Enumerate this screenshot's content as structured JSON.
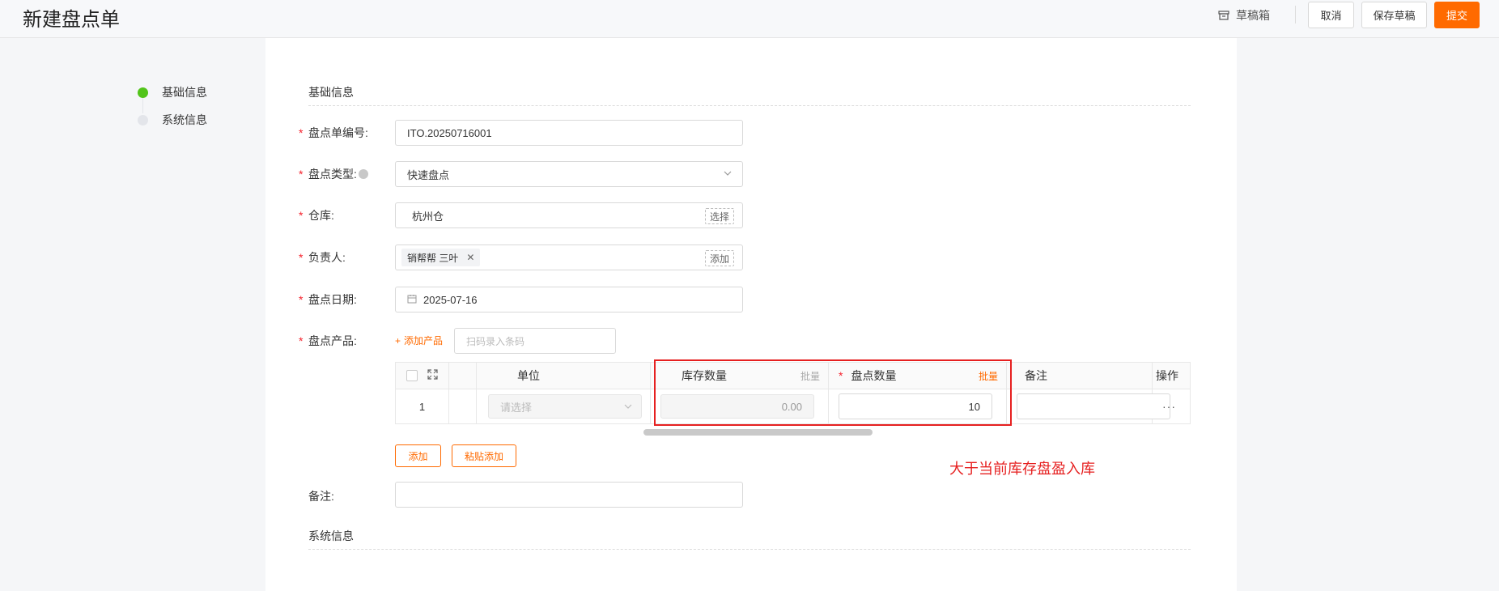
{
  "header": {
    "title": "新建盘点单",
    "draft_box_label": "草稿箱",
    "cancel_label": "取消",
    "save_draft_label": "保存草稿",
    "submit_label": "提交",
    "accent_color": "#ff6a00"
  },
  "steps": [
    {
      "label": "基础信息",
      "status": "active",
      "color": "#52c41a"
    },
    {
      "label": "系统信息",
      "status": "pending"
    }
  ],
  "sections": {
    "basic": "基础信息",
    "system": "系统信息"
  },
  "form": {
    "code": {
      "label": "盘点单编号:",
      "value": "ITO.20250716001"
    },
    "type": {
      "label": "盘点类型:",
      "value": "快速盘点"
    },
    "warehouse": {
      "label": "仓库:",
      "value": "杭州仓",
      "action": "选择"
    },
    "owner": {
      "label": "负责人:",
      "tag": "销帮帮 三叶",
      "action": "添加"
    },
    "date": {
      "label": "盘点日期:",
      "value": "2025-07-16"
    },
    "products": {
      "label": "盘点产品:",
      "add_label": "添加产品",
      "scan_placeholder": "扫码录入条码"
    },
    "note": {
      "label": "备注:",
      "value": ""
    }
  },
  "table": {
    "headers": {
      "unit": "单位",
      "stock": "库存数量",
      "count": "盘点数量",
      "note": "备注",
      "op": "操作",
      "batch": "批量"
    },
    "rows": [
      {
        "index": "1",
        "unit_placeholder": "请选择",
        "stock": "0.00",
        "count": "10",
        "note": "",
        "op": "···"
      }
    ]
  },
  "buttons": {
    "add": "添加",
    "paste_add": "粘贴添加"
  },
  "annotation": "大于当前库存盘盈入库"
}
